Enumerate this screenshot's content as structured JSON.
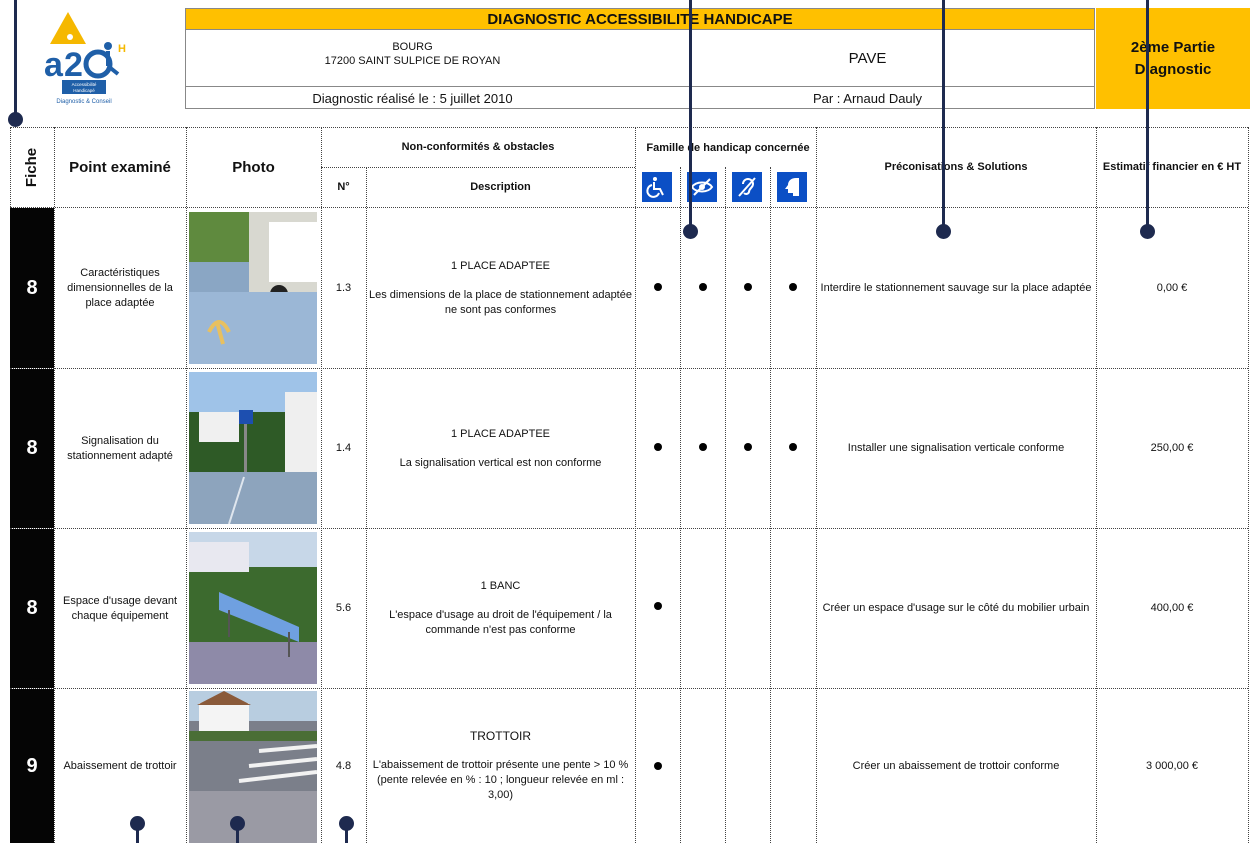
{
  "logo": {
    "text": "a2G",
    "superscript": "H",
    "tagline1": "Accessibilité",
    "tagline2": "Handicapé",
    "subline": "Diagnostic & Conseil"
  },
  "header": {
    "title": "DIAGNOSTIC ACCESSIBILITE HANDICAPE",
    "address_line1": "BOURG",
    "address_line2": "17200 SAINT SULPICE DE ROYAN",
    "program": "PAVE",
    "date_text": "Diagnostic réalisé le : 5 juillet 2010",
    "author_text": "Par : Arnaud Dauly",
    "part_line1": "2ème Partie",
    "part_line2": "Diagnostic"
  },
  "columns": {
    "fiche": "Fiche",
    "point": "Point examiné",
    "photo": "Photo",
    "nonconf": "Non-conformités & obstacles",
    "num": "N°",
    "description": "Description",
    "famille": "Famille de handicap concernée",
    "preco": "Préconisations & Solutions",
    "estimatif": "Estimatif financier en € HT"
  },
  "handicap_icons": [
    "wheelchair-icon",
    "eye-icon",
    "ear-icon",
    "head-icon"
  ],
  "rows": [
    {
      "fiche": "8",
      "point": "Caractéristiques dimensionnelles de la place adaptée",
      "num": "1.3",
      "title": "1 PLACE ADAPTEE",
      "description": "Les dimensions de la place de stationnement adaptée ne sont pas conformes",
      "bullets": [
        true,
        true,
        true,
        true
      ],
      "preconisation": "Interdire le stationnement sauvage sur la place adaptée",
      "estimatif": "0,00 €"
    },
    {
      "fiche": "8",
      "point": "Signalisation du stationnement adapté",
      "num": "1.4",
      "title": "1 PLACE ADAPTEE",
      "description": "La signalisation vertical est non conforme",
      "bullets": [
        true,
        true,
        true,
        true
      ],
      "preconisation": "Installer une signalisation verticale conforme",
      "estimatif": "250,00 €"
    },
    {
      "fiche": "8",
      "point": "Espace d'usage devant chaque équipement",
      "num": "5.6",
      "title": "1 BANC",
      "description": "L'espace d'usage au droit de l'équipement / la commande n'est pas conforme",
      "bullets": [
        true,
        false,
        false,
        false
      ],
      "preconisation": "Créer un espace d'usage sur le côté du mobilier urbain",
      "estimatif": "400,00 €"
    },
    {
      "fiche": "9",
      "point": "Abaissement de trottoir",
      "num": "4.8",
      "title": "TROTTOIR",
      "description": "L'abaissement de trottoir présente une pente > 10 % (pente relevée en % : 10 ; longueur relevée en ml : 3,00)",
      "bullets": [
        true,
        false,
        false,
        false
      ],
      "preconisation": "Créer un abaissement de trottoir conforme",
      "estimatif": "3 000,00 €"
    }
  ],
  "colors": {
    "header_yellow": "#ffc000",
    "icon_blue": "#0b4fc5",
    "callout": "#1e2a4f"
  }
}
